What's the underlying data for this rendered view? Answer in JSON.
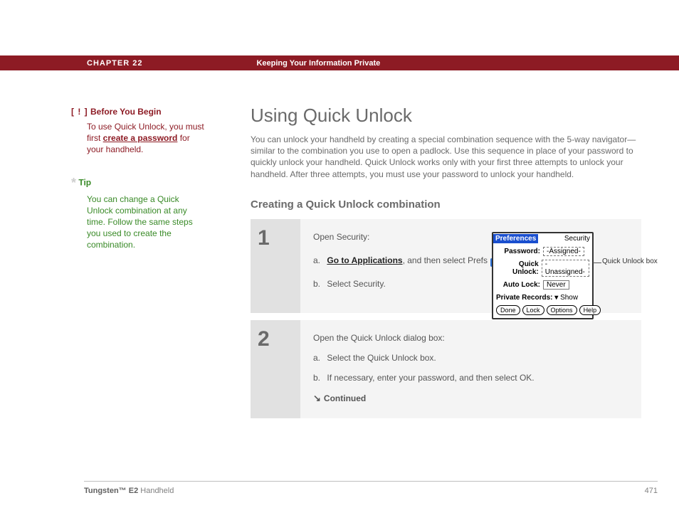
{
  "header": {
    "chapter": "CHAPTER 22",
    "chapter_title": "Keeping Your Information Private"
  },
  "sidebar": {
    "before_you_begin": {
      "prefix": "[ ! ]",
      "title": "Before You Begin",
      "body_pre": "To use Quick Unlock, you must first ",
      "link": "create a password",
      "body_post": " for your handheld."
    },
    "tip": {
      "star": "*",
      "title": "Tip",
      "body": "You can change a Quick Unlock combination at any time. Follow the same steps you used to create the combination."
    }
  },
  "main": {
    "title": "Using Quick Unlock",
    "intro": "You can unlock your handheld by creating a special combination sequence with the 5-way navigator—similar to the combination you use to open a padlock. Use this sequence in place of your password to quickly unlock your handheld. Quick Unlock works only with your first three attempts to unlock your handheld. After three attempts, you must use your password to unlock your handheld.",
    "section_title": "Creating a Quick Unlock combination"
  },
  "steps": [
    {
      "num": "1",
      "lead": "Open Security:",
      "a": {
        "lbl": "a.",
        "link": "Go to Applications",
        "mid": ", and then select Prefs ",
        "tail": "."
      },
      "b": {
        "lbl": "b.",
        "text": "Select Security."
      }
    },
    {
      "num": "2",
      "lead": "Open the Quick Unlock dialog box:",
      "a": {
        "lbl": "a.",
        "text": "Select the Quick Unlock box."
      },
      "b": {
        "lbl": "b.",
        "text": "If necessary, enter your password, and then select OK."
      },
      "continued": {
        "arrow": "↘",
        "label": "Continued"
      }
    }
  ],
  "prefs": {
    "title_left": "Preferences",
    "title_right": "Security",
    "rows": {
      "password": {
        "label": "Password:",
        "value": "-Assigned-"
      },
      "quick_unlock": {
        "label": "Quick Unlock:",
        "value": "-Unassigned-"
      },
      "auto_lock": {
        "label": "Auto Lock:",
        "value": "Never"
      }
    },
    "private_records": {
      "label": "Private Records:",
      "value": "Show",
      "arrow": "▾"
    },
    "buttons": [
      "Done",
      "Lock",
      "Options",
      "Help"
    ],
    "callout": "Quick Unlock box"
  },
  "footer": {
    "product_bold": "Tungsten™ E2",
    "product_rest": " Handheld",
    "page": "471"
  }
}
